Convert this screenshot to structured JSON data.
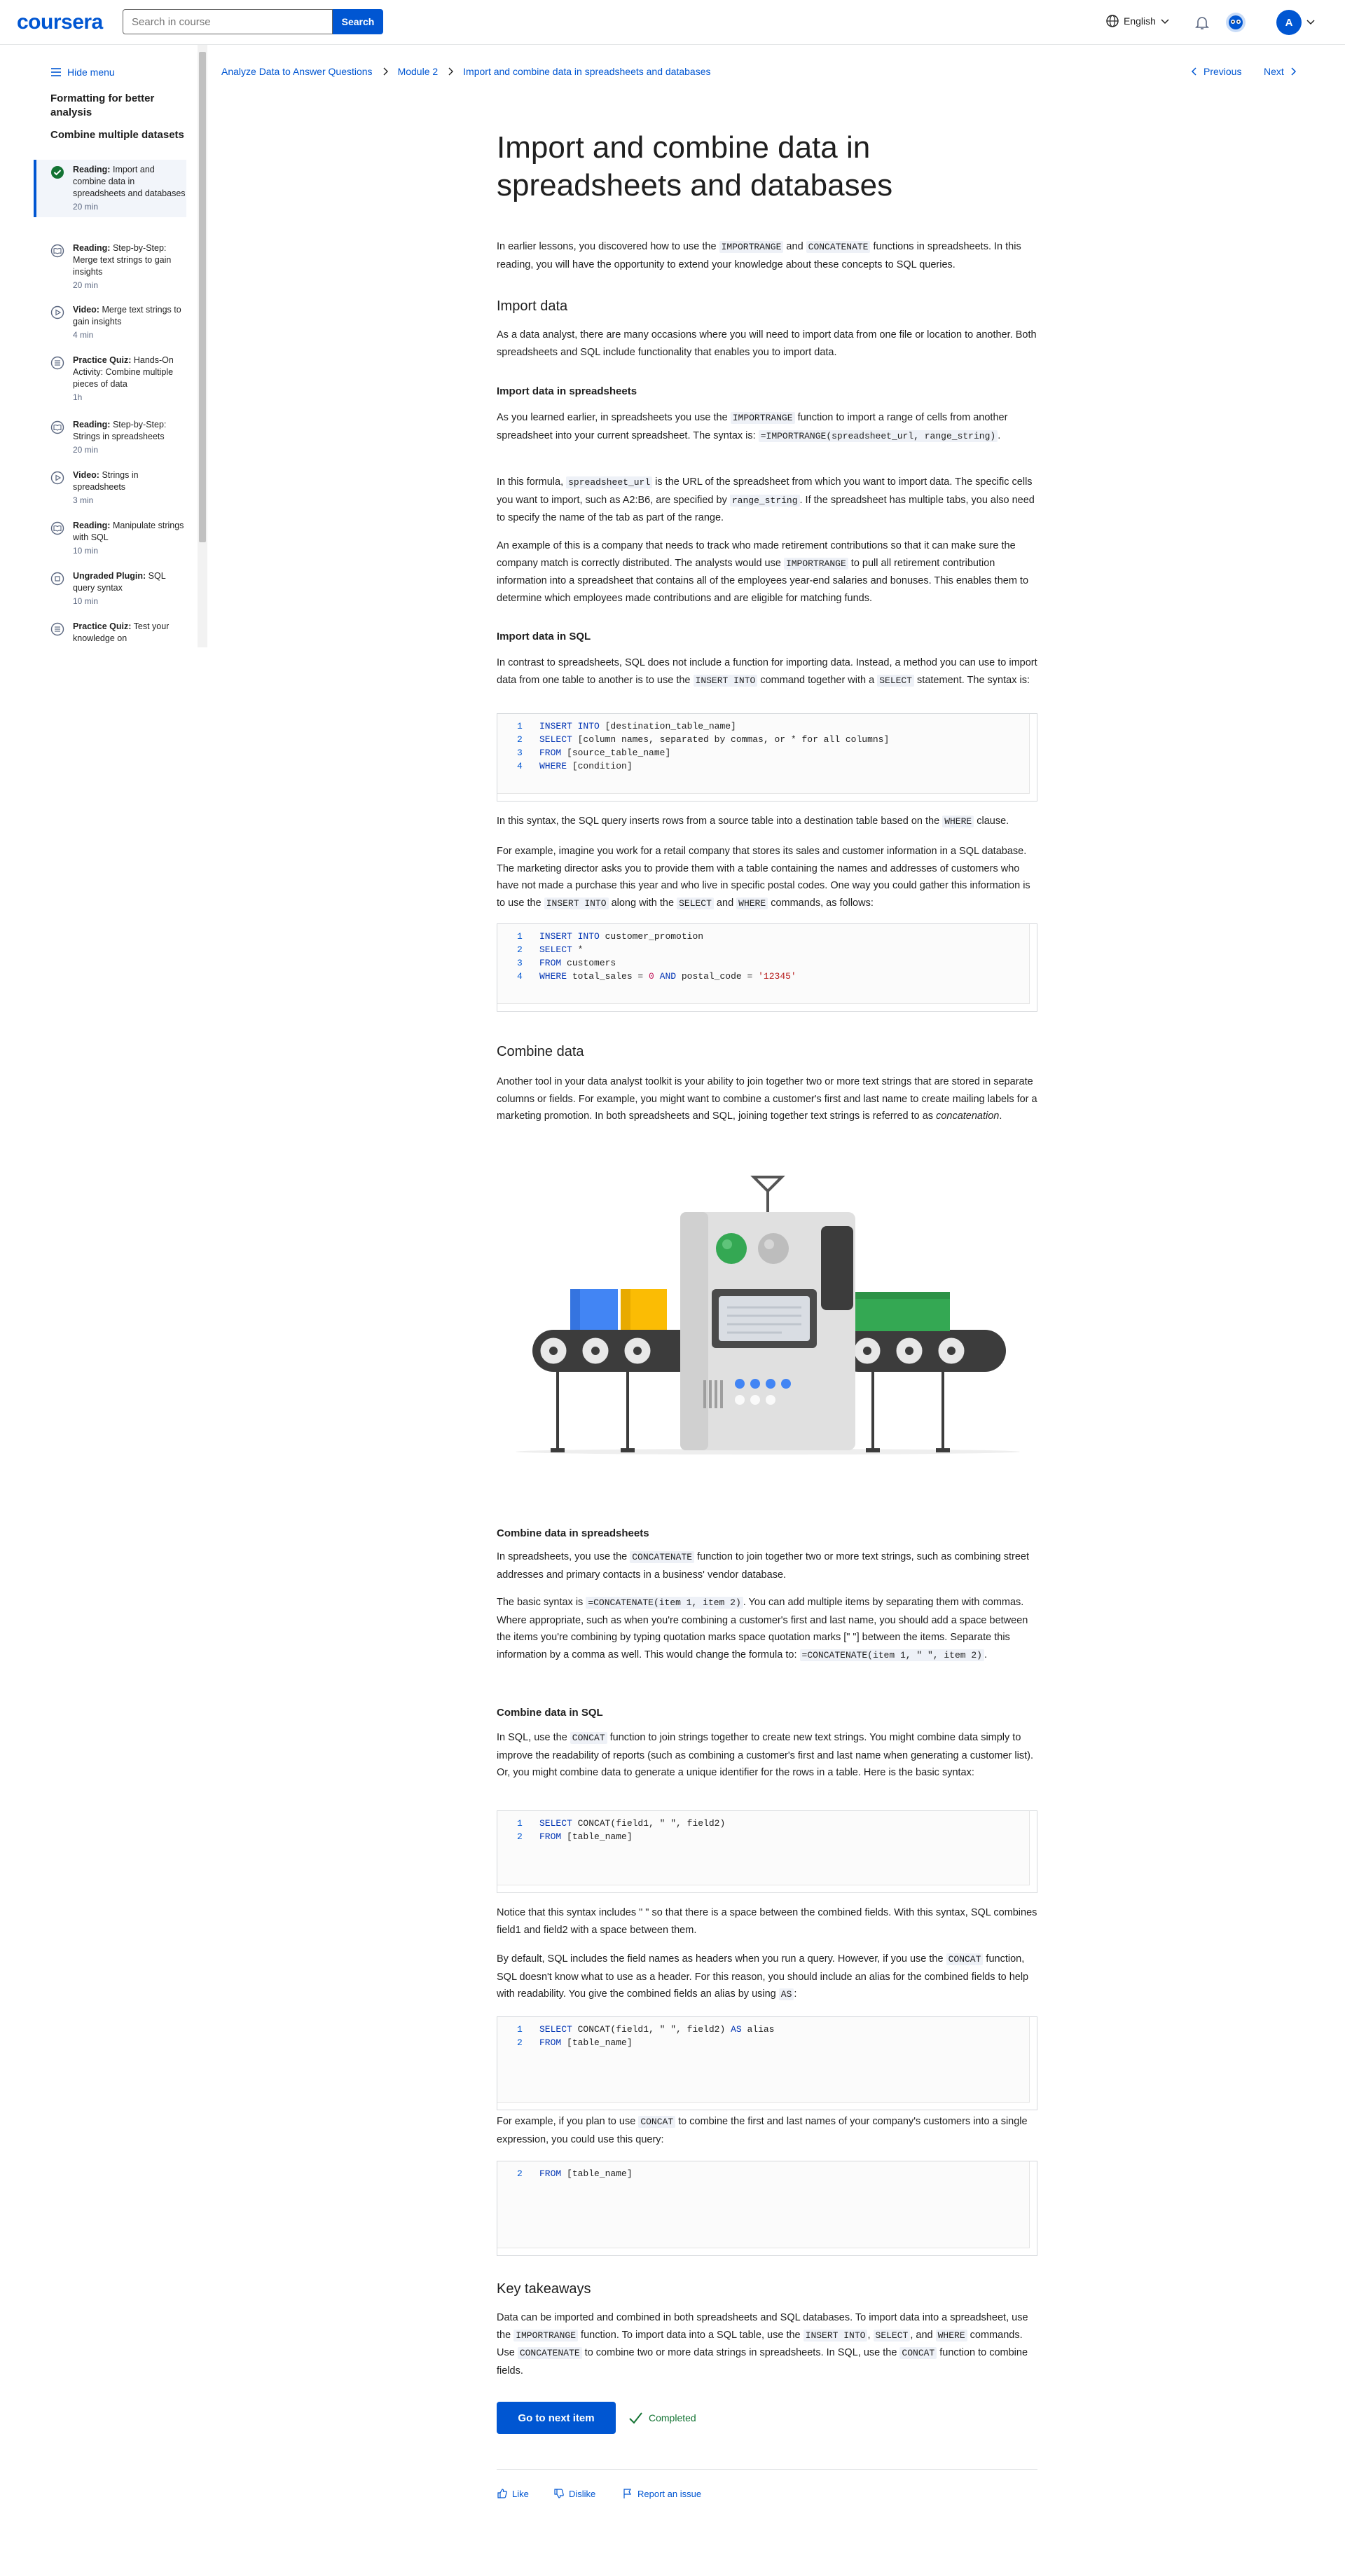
{
  "header": {
    "logo": "coursera",
    "search_placeholder": "Search in course",
    "search_button": "Search",
    "language": "English",
    "avatar_initial": "A"
  },
  "sidebar": {
    "hide_menu": "Hide menu",
    "module_prev": "Formatting for better analysis",
    "module_current": "Combine multiple datasets",
    "items": [
      {
        "type": "Reading:",
        "title": "Import and combine data in spreadsheets and databases",
        "meta": "20 min",
        "status": "completed"
      },
      {
        "type": "Reading:",
        "title": "Step-by-Step: Merge text strings to gain insights",
        "meta": "20 min",
        "status": "reading"
      },
      {
        "type": "Video:",
        "title": "Merge text strings to gain insights",
        "meta": "4 min",
        "status": "video"
      },
      {
        "type": "Practice Quiz:",
        "title": "Hands-On Activity: Combine multiple pieces of data",
        "meta": "1h",
        "status": "quiz"
      },
      {
        "type": "Reading:",
        "title": "Step-by-Step: Strings in spreadsheets",
        "meta": "20 min",
        "status": "reading"
      },
      {
        "type": "Video:",
        "title": "Strings in spreadsheets",
        "meta": "3 min",
        "status": "video"
      },
      {
        "type": "Reading:",
        "title": "Manipulate strings with SQL",
        "meta": "10 min",
        "status": "reading"
      },
      {
        "type": "Ungraded Plugin:",
        "title": "SQL query syntax",
        "meta": "10 min",
        "status": "plugin"
      },
      {
        "type": "Practice Quiz:",
        "title": "Test your knowledge on",
        "meta": "",
        "status": "quiz"
      }
    ]
  },
  "breadcrumb": {
    "items": [
      "Analyze Data to Answer Questions",
      "Module 2",
      "Import and combine data in spreadsheets and databases"
    ],
    "previous": "Previous",
    "next": "Next"
  },
  "article": {
    "title": "Import and combine data in spreadsheets and databases",
    "intro_a": "In earlier lessons, you discovered how to use the ",
    "intro_code1": "IMPORTRANGE",
    "intro_b": " and ",
    "intro_code2": "CONCATENATE",
    "intro_c": " functions in spreadsheets. In this reading, you will have the opportunity to extend your knowledge about these concepts to SQL queries.",
    "import_data_heading": "Import data",
    "import_data_p": "As a data analyst, there are many occasions where you will need to import data from one file or location to another. Both spreadsheets and SQL include functionality that enables you to import data.",
    "import_sheets_heading": "Import data in spreadsheets",
    "import_sheets_p1a": "As you learned earlier, in spreadsheets you use the ",
    "import_sheets_p1code": "IMPORTRANGE",
    "import_sheets_p1b": " function to import a range of cells from another spreadsheet into your current spreadsheet. The syntax is: ",
    "import_sheets_p1syntax": "=IMPORTRANGE(spreadsheet_url, range_string)",
    "import_sheets_p1c": ".",
    "import_sheets_p2a": "In this formula, ",
    "import_sheets_p2code1": "spreadsheet_url",
    "import_sheets_p2b": " is the URL of the spreadsheet from which you want to import data. The specific cells you want to import, such as A2:B6, are specified by ",
    "import_sheets_p2code2": "range_string",
    "import_sheets_p2c": ". If the spreadsheet has multiple tabs, you also need to specify the name of the tab as part of the range.",
    "import_sheets_p3a": "An example of this is a company that needs to track who made retirement contributions so that it can make sure the company match is correctly distributed. The analysts would use ",
    "import_sheets_p3code": "IMPORTRANGE",
    "import_sheets_p3b": " to pull all retirement contribution information into a spreadsheet that contains all of the employees year-end salaries and bonuses. This enables them to determine which employees made contributions and are eligible for matching funds.",
    "import_sql_heading": "Import data in SQL",
    "import_sql_p1a": "In contrast to spreadsheets, SQL does not include a function for importing data. Instead, a method you can use to import data from one table to another is to use the ",
    "import_sql_p1code1": "INSERT INTO",
    "import_sql_p1b": " command together with a ",
    "import_sql_p1code2": "SELECT",
    "import_sql_p1c": " statement. The syntax is:",
    "code1": [
      {
        "n": "1",
        "kw": "INSERT INTO",
        "rest": " [destination_table_name]"
      },
      {
        "n": "2",
        "kw": "SELECT",
        "rest": " [column names, separated by commas, or * for all columns]"
      },
      {
        "n": "3",
        "kw": "FROM",
        "rest": " [source_table_name]"
      },
      {
        "n": "4",
        "kw": "WHERE",
        "rest": " [condition]"
      }
    ],
    "import_sql_p2a": "In this syntax, the SQL query inserts rows from a source table into a destination table based on the ",
    "import_sql_p2code": "WHERE",
    "import_sql_p2b": " clause.",
    "import_sql_p3a": "For example, imagine you work for a retail company that stores its sales and customer information in a SQL database. The marketing director asks you to provide them with a table containing the names and addresses of customers who have not made a purchase this year and who live in specific postal codes. One way you could gather this information is to use the ",
    "import_sql_p3code1": "INSERT INTO",
    "import_sql_p3b": " along with the ",
    "import_sql_p3code2": "SELECT",
    "import_sql_p3c": " and ",
    "import_sql_p3code3": "WHERE",
    "import_sql_p3d": " commands, as follows:",
    "code2": [
      {
        "n": "1",
        "kw": "INSERT INTO",
        "rest": " customer_promotion"
      },
      {
        "n": "2",
        "kw": "SELECT",
        "rest": " *"
      },
      {
        "n": "3",
        "kw": "FROM",
        "rest": " customers"
      },
      {
        "n": "4",
        "kw": "WHERE",
        "rest": " total_sales = ",
        "num": "0",
        "and": " AND",
        "rest2": " postal_code = ",
        "str": "'12345'"
      }
    ],
    "combine_heading": "Combine data",
    "combine_p_a": "Another tool in your data analyst toolkit is your ability to join together two or more text strings that are stored in separate columns or fields. For example, you might want to combine a customer's first and last name to create mailing labels for a marketing promotion. In both spreadsheets and SQL, joining together text strings is referred to as ",
    "combine_p_em": "concatenation",
    "combine_p_b": ".",
    "combine_sheets_heading": "Combine data in spreadsheets",
    "combine_sheets_p1a": "In spreadsheets, you use the ",
    "combine_sheets_p1code": "CONCATENATE",
    "combine_sheets_p1b": " function to join together two or more text strings, such as combining street addresses and primary contacts in a business' vendor database.",
    "combine_sheets_p2a": "The basic syntax is ",
    "combine_sheets_p2code1": "=CONCATENATE(item 1, item 2)",
    "combine_sheets_p2b": ". You can add multiple items by separating them with commas. Where appropriate, such as when you're combining a customer's first and last name, you should add a space between the items you're combining by typing quotation marks space quotation marks [\" \"] between the items. Separate this information by a comma as well. This would change the formula to: ",
    "combine_sheets_p2code2": "=CONCATENATE(item 1, \" \", item 2)",
    "combine_sheets_p2c": ".",
    "combine_sql_heading": "Combine data in SQL",
    "combine_sql_p1a": "In SQL, use the ",
    "combine_sql_p1code": "CONCAT",
    "combine_sql_p1b": " function to join strings together to create new text strings. You might combine data simply to improve the readability of reports (such as combining a customer's first and last name when generating a customer list). Or, you might combine data to generate a unique identifier for the rows in a table. Here is the basic syntax:",
    "code3": [
      {
        "n": "1",
        "kw": "SELECT",
        "rest": " CONCAT(field1, \" \", field2)"
      },
      {
        "n": "2",
        "kw": "FROM",
        "rest": " [table_name]"
      }
    ],
    "combine_sql_p2": "Notice that this syntax includes \" \" so that there is a space between the combined fields. With this syntax, SQL combines field1 and field2 with a space between them.",
    "combine_sql_p3a": "By default, SQL includes the field names as headers when you run a query. However, if you use the ",
    "combine_sql_p3code1": "CONCAT",
    "combine_sql_p3b": " function, SQL doesn't know what to use as a header. For this reason, you should include an alias for the combined fields to help with readability. You give the combined fields an alias by using ",
    "combine_sql_p3code2": "AS",
    "combine_sql_p3c": ":",
    "code4": [
      {
        "n": "1",
        "kw": "SELECT",
        "rest": " CONCAT(field1, \" \", field2) ",
        "kw2": "AS",
        "rest2": " alias"
      },
      {
        "n": "2",
        "kw": "FROM",
        "rest": " [table_name]"
      }
    ],
    "combine_sql_p4a": "For example, if you plan to use ",
    "combine_sql_p4code": "CONCAT",
    "combine_sql_p4b": " to combine the first and last names of your company's customers into a single expression, you could use this query:",
    "code5": [
      {
        "n": "2",
        "kw": "FROM",
        "rest": " [table_name]"
      }
    ],
    "takeaways_heading": "Key takeaways",
    "takeaways_a": "Data can be imported and combined in both spreadsheets and SQL databases. To import data into a spreadsheet, use the ",
    "takeaways_code1": "IMPORTRANGE",
    "takeaways_b": " function. To import data into a SQL table, use the ",
    "takeaways_code2": "INSERT INTO",
    "takeaways_c": ", ",
    "takeaways_code3": "SELECT",
    "takeaways_d": ", and ",
    "takeaways_code4": "WHERE",
    "takeaways_e": " commands. Use ",
    "takeaways_code5": "CONCATENATE",
    "takeaways_f": " to combine two or more data strings in spreadsheets. In SQL, use the ",
    "takeaways_code6": "CONCAT",
    "takeaways_g": " function to combine fields."
  },
  "footer": {
    "next_button": "Go to next item",
    "completed": "Completed",
    "like": "Like",
    "dislike": "Dislike",
    "report": "Report an issue"
  },
  "colors": {
    "brand": "#0056d2",
    "success": "#137333"
  }
}
